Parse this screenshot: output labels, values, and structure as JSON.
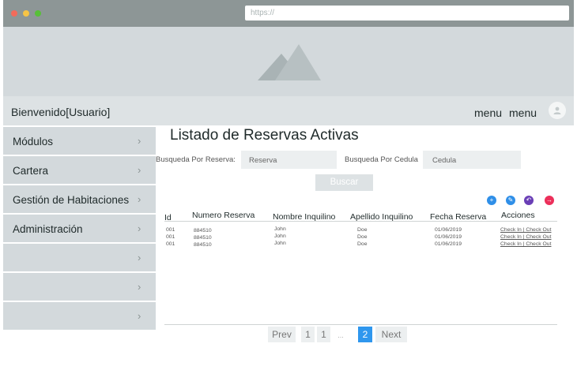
{
  "browser": {
    "url_placeholder": "https://"
  },
  "header": {
    "welcome": "Bienvenido[Usuario]",
    "menu_items": [
      "menu",
      "menu"
    ]
  },
  "sidebar": {
    "items": [
      {
        "label": "Módulos"
      },
      {
        "label": "Cartera"
      },
      {
        "label": "Gestión de Habitaciones"
      },
      {
        "label": "Administración"
      },
      {
        "label": ""
      },
      {
        "label": ""
      },
      {
        "label": ""
      }
    ],
    "chevron": "›"
  },
  "main": {
    "title": "Listado de Reservas Activas",
    "search": {
      "reserva_label": "Busqueda Por Reserva:",
      "reserva_placeholder": "Reserva",
      "cedula_label": "Busqueda Por Cedula",
      "cedula_placeholder": "Cedula",
      "button": "Buscar"
    },
    "actions": [
      "add-icon",
      "edit-icon",
      "undo-icon",
      "exit-icon"
    ],
    "table": {
      "headers": [
        "Id",
        "Numero Reserva",
        "Nombre Inquilino",
        "Apellido Inquilino",
        "Fecha Reserva",
        "Acciones"
      ],
      "rows": [
        {
          "id": "001",
          "numero": "884510",
          "nombre": "John",
          "apellido": "Doe",
          "fecha": "01/06/2019",
          "acciones": "Check In | Check Out"
        },
        {
          "id": "001",
          "numero": "884510",
          "nombre": "John",
          "apellido": "Doe",
          "fecha": "01/06/2019",
          "acciones": "Check In | Check Out"
        },
        {
          "id": "001",
          "numero": "884510",
          "nombre": "John",
          "apellido": "Doe",
          "fecha": "01/06/2019",
          "acciones": "Check In | Check Out"
        }
      ]
    },
    "pagination": {
      "prev": "Prev",
      "pages": [
        "1",
        "1"
      ],
      "ellipsis": "...",
      "current": "2",
      "next": "Next"
    }
  },
  "colors": {
    "chrome": "#8d9696",
    "hero": "#d3d9dc",
    "accent_blue": "#2f97ee",
    "accent_purple": "#6a3fb6",
    "accent_pink": "#ec2f5a"
  }
}
